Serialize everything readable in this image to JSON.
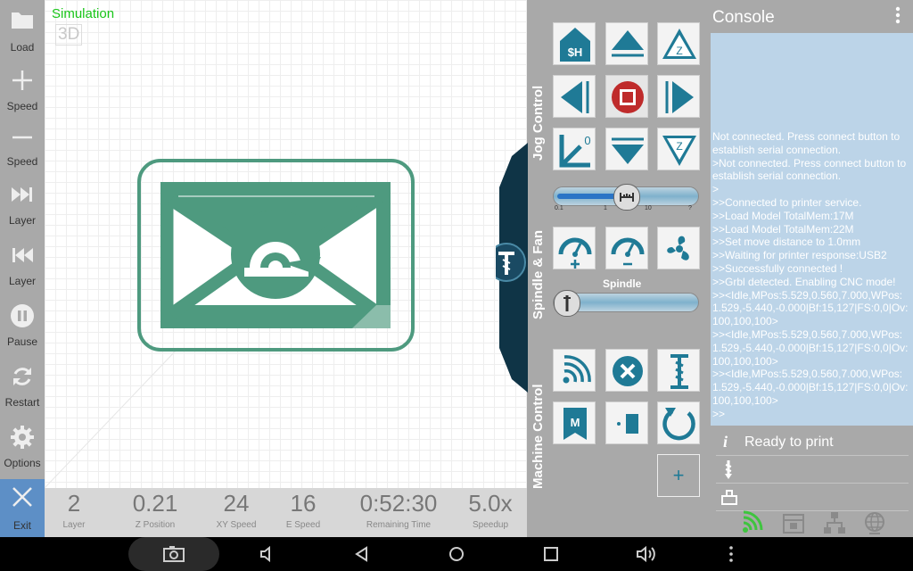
{
  "left_toolbar": {
    "items": [
      {
        "label": "Load",
        "icon": "folder-icon"
      },
      {
        "label": "Speed",
        "icon": "plus-icon"
      },
      {
        "label": "Speed",
        "icon": "minus-icon"
      },
      {
        "label": "Layer",
        "icon": "skip-forward-icon"
      },
      {
        "label": "Layer",
        "icon": "skip-back-icon"
      },
      {
        "label": "Pause",
        "icon": "pause-icon"
      },
      {
        "label": "Restart",
        "icon": "refresh-icon"
      },
      {
        "label": "Options",
        "icon": "gear-icon"
      }
    ],
    "exit_label": "Exit"
  },
  "viewport": {
    "mode_label": "Simulation",
    "view_toggle": "3D"
  },
  "stats": [
    {
      "value": "2",
      "label": "Layer"
    },
    {
      "value": "0.21",
      "label": "Z Position"
    },
    {
      "value": "24",
      "label": "XY Speed"
    },
    {
      "value": "16",
      "label": "E Speed"
    },
    {
      "value": "0:52:30",
      "label": "Remaining Time"
    },
    {
      "value": "5.0x",
      "label": "Speedup"
    }
  ],
  "controls": {
    "jog_section_label": "Jog Control",
    "spindle_section_label": "Spindle & Fan",
    "machine_section_label": "Machine Control",
    "jog_home_label": "$H",
    "jog_step_ticks": [
      "0.1",
      "1",
      "10",
      "?"
    ],
    "jog_distance_fraction": 0.5,
    "spindle_label": "Spindle",
    "spindle_fraction": 0.0,
    "add_label": "+"
  },
  "console": {
    "title": "Console",
    "lines": [
      "Not connected. Press connect button to establish serial connection.",
      ">Not connected. Press connect button to establish serial connection.",
      ">",
      ">>Connected to printer service.",
      ">>Load Model TotalMem:17M",
      ">>Load Model TotalMem:22M",
      ">>Set move distance to 1.0mm",
      ">>Waiting for printer response:USB2",
      ">>Successfully connected !",
      ">>Grbl detected. Enabling CNC mode!",
      ">><Idle,MPos:5.529,0.560,7.000,WPos:1.529,-5.440,-0.000|Bf:15,127|FS:0,0|Ov:100,100,100>",
      ">><Idle,MPos:5.529,0.560,7.000,WPos:1.529,-5.440,-0.000|Bf:15,127|FS:0,0|Ov:100,100,100>",
      ">><Idle,MPos:5.529,0.560,7.000,WPos:1.529,-5.440,-0.000|Bf:15,127|FS:0,0|Ov:100,100,100>",
      ">>"
    ],
    "status": "Ready to print"
  },
  "colors": {
    "toolbar_bg": "#a9a9a9",
    "exit_bg": "#5d8fc6",
    "console_bg": "#bcd4e8",
    "icon_teal": "#1f7a96",
    "model_green": "#4e9a7f",
    "drawer_dark": "#0f3446",
    "simulation_text": "#19c519",
    "wifi_green": "#3ec43e"
  }
}
